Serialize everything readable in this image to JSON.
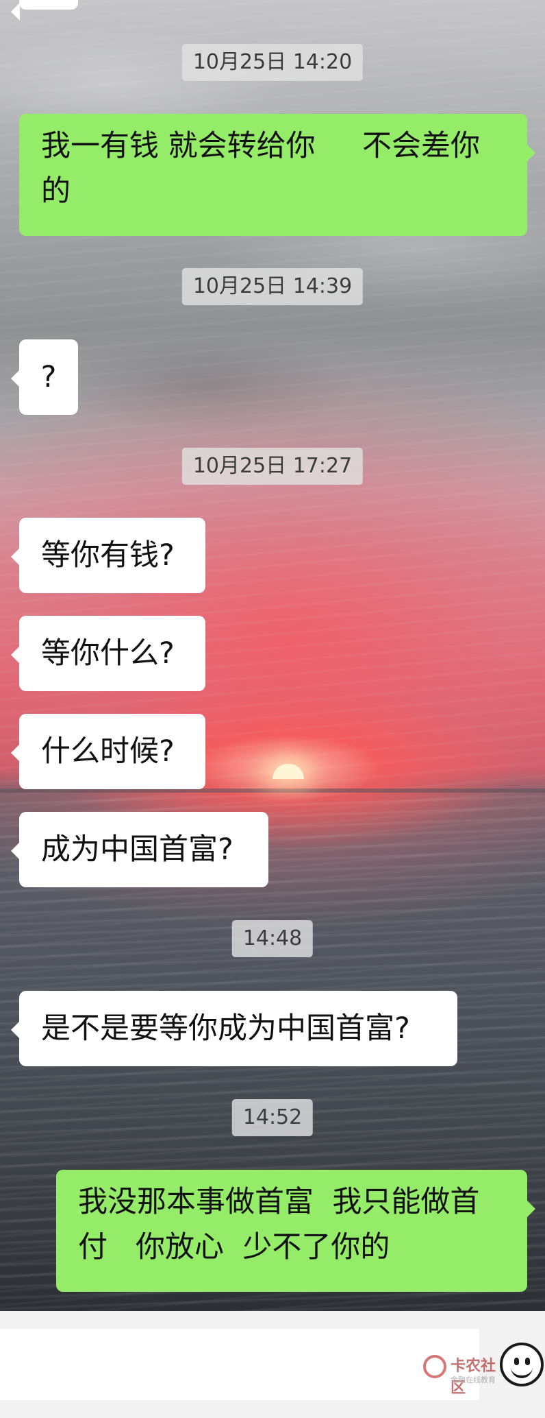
{
  "chat": {
    "messages": [
      {
        "type": "timestamp",
        "text": "10月25日 14:20"
      },
      {
        "type": "sent",
        "text": "我一有钱 就会转给你     不会差你的"
      },
      {
        "type": "timestamp",
        "text": "10月25日 14:39"
      },
      {
        "type": "received",
        "text": "?"
      },
      {
        "type": "timestamp",
        "text": "10月25日 17:27"
      },
      {
        "type": "received",
        "text": "等你有钱?"
      },
      {
        "type": "received",
        "text": "等你什么?"
      },
      {
        "type": "received",
        "text": "什么时候?"
      },
      {
        "type": "received",
        "text": "成为中国首富?"
      },
      {
        "type": "timestamp",
        "text": "14:48"
      },
      {
        "type": "received",
        "text": "是不是要等你成为中国首富?"
      },
      {
        "type": "timestamp",
        "text": "14:52"
      },
      {
        "type": "sent",
        "text": "我没那本事做首富  我只能做首付   你放心  少不了你的"
      }
    ]
  },
  "input_bar": {
    "emoji_icon": "emoji-icon",
    "watermark_text": "卡农社区",
    "watermark_sub": "金融在线教育"
  },
  "colors": {
    "sent_bubble": "#95ec69",
    "received_bubble": "#ffffff",
    "timestamp_bg": "#e1e1e1"
  }
}
